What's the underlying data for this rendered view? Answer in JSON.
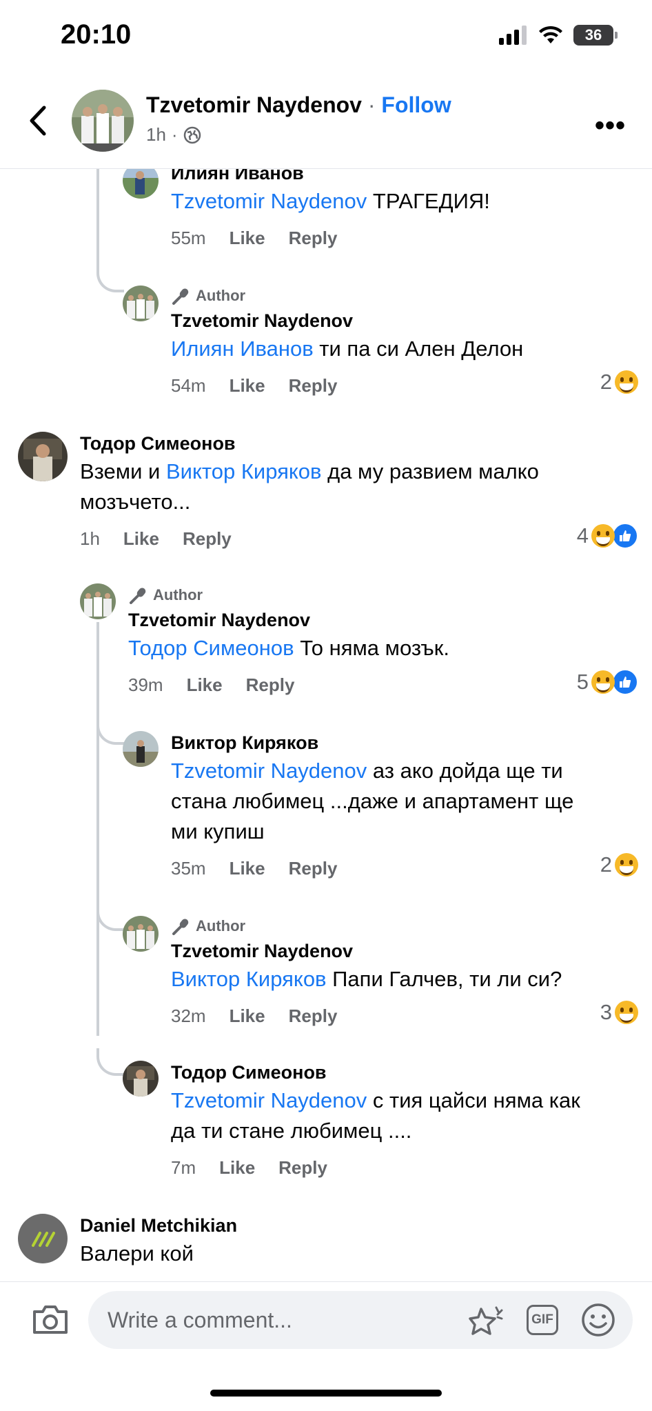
{
  "status": {
    "time": "20:10",
    "battery": "36"
  },
  "header": {
    "name": "Tzvetomir Naydenov",
    "dot": " · ",
    "follow": "Follow",
    "time": "1h",
    "sep": "·"
  },
  "comments": {
    "c1": {
      "name": "Илиян Иванов",
      "mention": "Tzvetomir Naydenov",
      "text": " ТРАГЕДИЯ!",
      "time": "55m",
      "like": "Like",
      "reply": "Reply"
    },
    "c2": {
      "author": "Author",
      "name": "Tzvetomir Naydenov",
      "mention": "Илиян Иванов",
      "text": " ти па си Ален Делон",
      "time": "54m",
      "like": "Like",
      "reply": "Reply",
      "reactions": "2"
    },
    "c3": {
      "name": "Тодор Симеонов",
      "text_a": "Вземи и ",
      "mention": "Виктор Киряков",
      "text_b": " да му развием малко",
      "text_c": "мозъчето...",
      "time": "1h",
      "like": "Like",
      "reply": "Reply",
      "reactions": "4"
    },
    "c4": {
      "author": "Author",
      "name": "Tzvetomir Naydenov",
      "mention": "Тодор Симеонов",
      "text": " То няма мозък.",
      "time": "39m",
      "like": "Like",
      "reply": "Reply",
      "reactions": "5"
    },
    "c5": {
      "name": "Виктор Киряков",
      "mention": "Tzvetomir Naydenov",
      "text_a": " аз ако дойда ще ти",
      "text_b": "стана любимец ...даже и апартамент ще",
      "text_c": "ми купиш",
      "time": "35m",
      "like": "Like",
      "reply": "Reply",
      "reactions": "2"
    },
    "c6": {
      "author": "Author",
      "name": "Tzvetomir Naydenov",
      "mention": "Виктор Киряков",
      "text": " Папи Галчев, ти ли си?",
      "time": "32m",
      "like": "Like",
      "reply": "Reply",
      "reactions": "3"
    },
    "c7": {
      "name": "Тодор Симеонов",
      "mention": "Tzvetomir Naydenov",
      "text_a": " с тия цайси няма как",
      "text_b": "да ти стане любимец ....",
      "time": "7m",
      "like": "Like",
      "reply": "Reply"
    },
    "c8": {
      "name": "Daniel Metchikian",
      "text": "Валери кой"
    }
  },
  "composer": {
    "placeholder": "Write a comment...",
    "gif": "GIF"
  },
  "colors": {
    "link": "#1877f2",
    "meta": "#65676b",
    "line": "#ccd0d5"
  }
}
